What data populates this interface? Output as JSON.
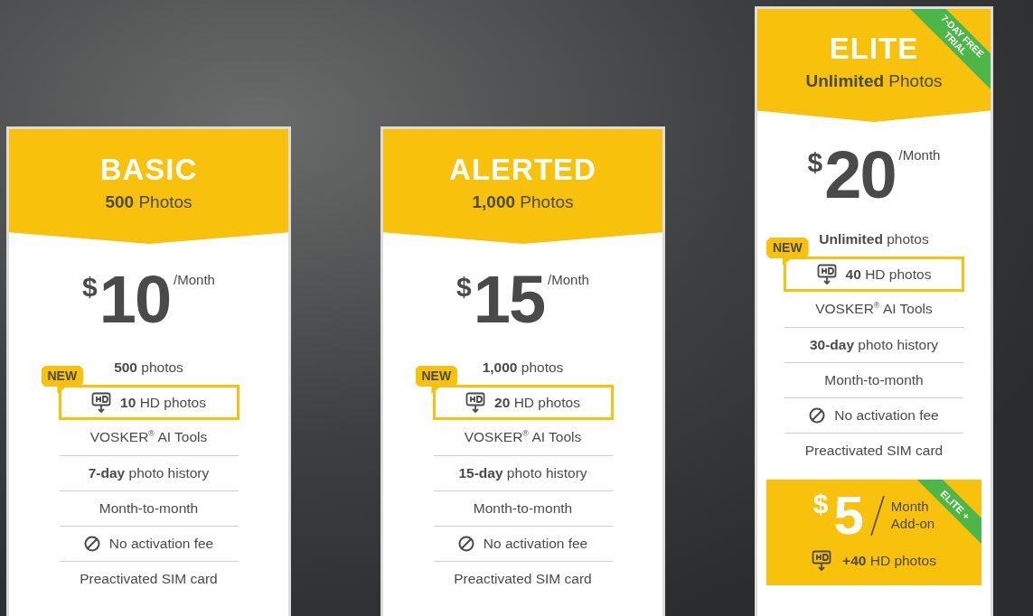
{
  "plans": [
    {
      "title": "BASIC",
      "subtitle": "**500** Photos",
      "featured": false,
      "currency": "$",
      "amount": "10",
      "period": "/Month",
      "features": [
        {
          "kind": "plain",
          "text": "**500** photos"
        },
        {
          "kind": "hd",
          "badge": "NEW",
          "text": "**10** HD photos"
        },
        {
          "kind": "plain",
          "text": "VOSKER$^{®}$ AI Tools"
        },
        {
          "kind": "plain",
          "text": "**7-day** photo history"
        },
        {
          "kind": "plain",
          "text": "Month-to-month"
        },
        {
          "kind": "no-fee",
          "text": "No activation fee"
        },
        {
          "kind": "plain",
          "text": "Preactivated SIM card"
        }
      ]
    },
    {
      "title": "ALERTED",
      "subtitle": "**1,000** Photos",
      "featured": false,
      "currency": "$",
      "amount": "15",
      "period": "/Month",
      "features": [
        {
          "kind": "plain",
          "text": "**1,000** photos"
        },
        {
          "kind": "hd",
          "badge": "NEW",
          "text": "**20** HD photos"
        },
        {
          "kind": "plain",
          "text": "VOSKER$^{®}$ AI Tools"
        },
        {
          "kind": "plain",
          "text": "**15-day** photo history"
        },
        {
          "kind": "plain",
          "text": "Month-to-month"
        },
        {
          "kind": "no-fee",
          "text": "No activation fee"
        },
        {
          "kind": "plain",
          "text": "Preactivated SIM card"
        }
      ]
    },
    {
      "title": "ELITE",
      "subtitle": "**Unlimited** Photos",
      "featured": true,
      "ribbon": "7-DAY FREE TRIAL",
      "currency": "$",
      "amount": "20",
      "period": "/Month",
      "features": [
        {
          "kind": "plain",
          "text": "**Unlimited** photos"
        },
        {
          "kind": "hd",
          "badge": "NEW",
          "text": "**40** HD photos"
        },
        {
          "kind": "plain",
          "text": "VOSKER$^{®}$ AI Tools"
        },
        {
          "kind": "plain",
          "text": "**30-day** photo history"
        },
        {
          "kind": "plain",
          "text": "Month-to-month"
        },
        {
          "kind": "no-fee",
          "text": "No activation fee"
        },
        {
          "kind": "plain",
          "text": "Preactivated SIM card"
        }
      ],
      "addon": {
        "currency": "$",
        "amount": "5",
        "period": "Month",
        "label": "Add-on",
        "ribbon": "ELITE +",
        "feature": "**+40** HD photos"
      }
    }
  ]
}
